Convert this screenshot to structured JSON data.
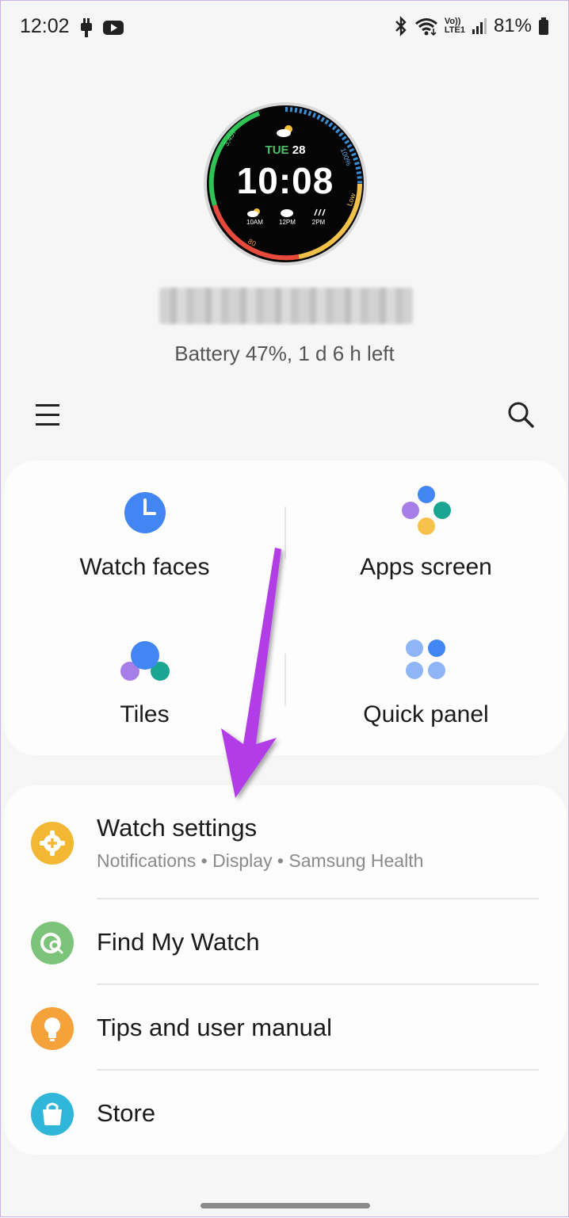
{
  "status_bar": {
    "time": "12:02",
    "battery_percent": "81%",
    "volte_label_top": "Vo))",
    "volte_label_bottom": "LTE1",
    "left_icons": [
      "notification-app-icon",
      "youtube-icon"
    ],
    "right_icons": [
      "bluetooth-icon",
      "wifi-icon",
      "volte-icon",
      "signal-icon",
      "battery-icon"
    ]
  },
  "watch": {
    "face": {
      "day": "TUE",
      "date": "28",
      "time": "10:08",
      "steps": "3,457",
      "percent": "100%",
      "level": "Low",
      "heart": "80",
      "forecast": [
        {
          "time": "10AM",
          "icon": "sun-cloud-icon"
        },
        {
          "time": "12PM",
          "icon": "cloud-icon"
        },
        {
          "time": "2PM",
          "icon": "rain-icon"
        }
      ]
    },
    "battery_status": "Battery 47%, 1 d 6 h left"
  },
  "toolbar": {
    "menu_icon": "hamburger-menu-icon",
    "search_icon": "search-icon"
  },
  "quick_actions": [
    {
      "label": "Watch faces",
      "icon": "clock-icon"
    },
    {
      "label": "Apps screen",
      "icon": "apps-dots-icon"
    },
    {
      "label": "Tiles",
      "icon": "tiles-icon"
    },
    {
      "label": "Quick panel",
      "icon": "quick-panel-icon"
    }
  ],
  "menu_items": [
    {
      "title": "Watch settings",
      "subtitle": "Notifications • Display • Samsung Health",
      "icon": "settings-gear-icon",
      "color": "#f4b733"
    },
    {
      "title": "Find My Watch",
      "icon": "find-watch-icon",
      "color": "#7cc47a"
    },
    {
      "title": "Tips and user manual",
      "icon": "lightbulb-icon",
      "color": "#f5a23a"
    },
    {
      "title": "Store",
      "icon": "shopping-bag-icon",
      "color": "#2fb6d8"
    }
  ],
  "annotation": {
    "icon": "purple-arrow-icon",
    "color": "#b23ee6"
  },
  "colors": {
    "background": "#f6f6f6",
    "card": "#fdfdfd",
    "accent_blue": "#4286f4",
    "accent_purple": "#a77ee8",
    "accent_green": "#1aa592",
    "accent_yellow": "#f7c24a"
  }
}
